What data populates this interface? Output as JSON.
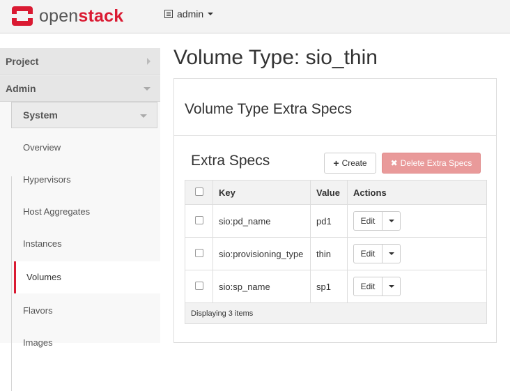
{
  "header": {
    "logo_text_light": "open",
    "logo_text_bold": "stack",
    "project_label": "admin",
    "brand_color": "#da1a32"
  },
  "sidebar": {
    "project": "Project",
    "admin": "Admin",
    "system": "System",
    "items": [
      {
        "label": "Overview"
      },
      {
        "label": "Hypervisors"
      },
      {
        "label": "Host Aggregates"
      },
      {
        "label": "Instances"
      },
      {
        "label": "Volumes"
      },
      {
        "label": "Flavors"
      },
      {
        "label": "Images"
      }
    ],
    "active": "Volumes"
  },
  "main": {
    "title": "Volume Type: sio_thin",
    "panel_title": "Volume Type Extra Specs",
    "section_title": "Extra Specs",
    "create_label": "Create",
    "delete_label": "Delete Extra Specs",
    "table": {
      "columns": [
        "Key",
        "Value",
        "Actions"
      ],
      "rows": [
        {
          "key": "sio:pd_name",
          "value": "pd1",
          "action": "Edit"
        },
        {
          "key": "sio:provisioning_type",
          "value": "thin",
          "action": "Edit"
        },
        {
          "key": "sio:sp_name",
          "value": "sp1",
          "action": "Edit"
        }
      ],
      "footer": "Displaying 3 items"
    }
  }
}
